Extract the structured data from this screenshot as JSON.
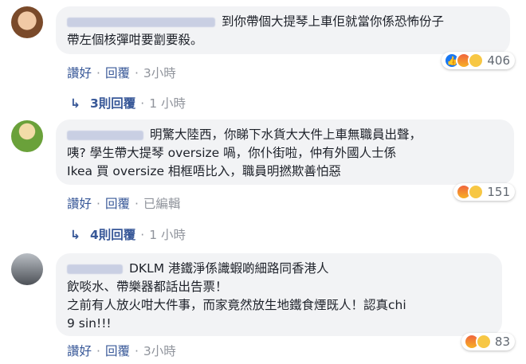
{
  "comments": [
    {
      "lines": [
        "到你帶個大提琴上車佢就當你係恐怖份子",
        "帶左個核彈咁要劏要殺。"
      ],
      "actions": {
        "like": "讚好",
        "reply": "回覆",
        "time": "3小時"
      },
      "reactions": {
        "count": "406",
        "icons": [
          "like-icon",
          "angry-icon",
          "sad-icon"
        ]
      },
      "replies": {
        "label": "3則回覆",
        "time": "1 小時"
      }
    },
    {
      "lines": [
        "明驚大陸西，你睇下水貨大大件上車無職員出聲，",
        "咦? 學生帶大提琴 oversize 喎，你仆街啦，仲有外國人士係",
        "Ikea 買 oversize 相框唔比入，職員明撚欺善怕惡"
      ],
      "actions": {
        "like": "讚好",
        "reply": "回覆",
        "edited": "已編輯"
      },
      "reactions": {
        "count": "151",
        "icons": [
          "angry-icon",
          "sad-icon"
        ]
      },
      "replies": {
        "label": "4則回覆",
        "time": "1 小時"
      }
    },
    {
      "lines": [
        "DKLM 港鐵淨係識蝦啲細路同香港人",
        "飲啖水、帶樂器都話出告票！",
        "之前有人放火咁大件事，而家竟然放生地鐵食煙既人！認真chi",
        "9 sin!!!"
      ],
      "actions": {
        "like": "讚好",
        "reply": "回覆",
        "time": "3小時"
      },
      "reactions": {
        "count": "83",
        "icons": [
          "angry-icon",
          "sad-icon"
        ]
      }
    }
  ],
  "colors": {
    "link": "#385898",
    "muted": "#90949c",
    "bubble": "#f2f3f5",
    "like": "#1877f2"
  }
}
